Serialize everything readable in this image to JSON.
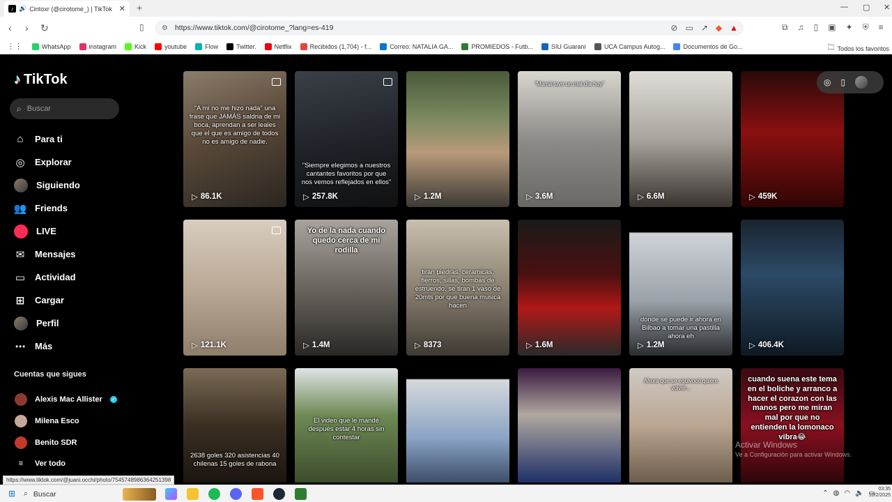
{
  "browser": {
    "tab_title": "Cintoxr (@cirotome_) | TikTok",
    "url": "https://www.tiktok.com/@cirotome_?lang=es-419",
    "bookmarks": [
      {
        "label": "WhatsApp",
        "color": "#25d366"
      },
      {
        "label": "instagram",
        "color": "#e1306c"
      },
      {
        "label": "Kick",
        "color": "#53fc18"
      },
      {
        "label": "youtube",
        "color": "#ff0000"
      },
      {
        "label": "Flow",
        "color": "#00b5ad"
      },
      {
        "label": "Twitter.",
        "color": "#000000"
      },
      {
        "label": "Netflix",
        "color": "#e50914"
      },
      {
        "label": "Recibidos (1,704) - f...",
        "color": "#ea4335"
      },
      {
        "label": "Correo: NATALIA GA...",
        "color": "#0078d4"
      },
      {
        "label": "PROMIEDOS - Futb...",
        "color": "#2e7d32"
      },
      {
        "label": "SIU Guaraní",
        "color": "#1565c0"
      },
      {
        "label": "UCA Campus Autog...",
        "color": "#555555"
      },
      {
        "label": "Documentos de Go...",
        "color": "#4285f4"
      }
    ],
    "bookmarks_folder": "Todos los favoritos"
  },
  "sidebar": {
    "logo": "TikTok",
    "search_placeholder": "Buscar",
    "nav": [
      {
        "label": "Para ti",
        "icon": "home-icon",
        "glyph": "⌂"
      },
      {
        "label": "Explorar",
        "icon": "compass-icon",
        "glyph": "◎"
      },
      {
        "label": "Siguiendo",
        "icon": "avatar",
        "glyph": ""
      },
      {
        "label": "Friends",
        "icon": "friends-icon",
        "glyph": "👥"
      },
      {
        "label": "LIVE",
        "icon": "live-avatar",
        "glyph": ""
      },
      {
        "label": "Mensajes",
        "icon": "message-icon",
        "glyph": "✉"
      },
      {
        "label": "Actividad",
        "icon": "activity-icon",
        "glyph": "▭"
      },
      {
        "label": "Cargar",
        "icon": "upload-icon",
        "glyph": "⊞"
      },
      {
        "label": "Perfil",
        "icon": "profile-avatar",
        "glyph": ""
      },
      {
        "label": "Más",
        "icon": "more-icon",
        "glyph": "⋯"
      }
    ],
    "following_title": "Cuentas que sigues",
    "following": [
      {
        "name": "Alexis Mac Allister",
        "verified": true,
        "color": "#8a3b2e"
      },
      {
        "name": "Milena Esco",
        "verified": false,
        "color": "#c8a89a"
      },
      {
        "name": "Benito SDR",
        "verified": false,
        "color": "#c0392b"
      }
    ],
    "see_all": "Ver todo"
  },
  "videos": [
    {
      "views": "86.1K",
      "caption": "\"A mi no me hizo nada\" una frase que JAMÁS saldria de mi boca, aprendan a ser leales que el que es amigo de todos no es amigo de nadie.",
      "style": "normal",
      "pinned": true,
      "bg": "linear-gradient(160deg,#8b7d6b 0%,#5a4a3a 45%,#2b2620 100%)"
    },
    {
      "views": "257.8K",
      "caption": "\"Siempre elegimos a nuestros cantantes favoritos por que nos vemos reflejados en ellos\"",
      "style": "low",
      "pinned": true,
      "bg": "linear-gradient(170deg,#3a4048 0%,#1c1f24 60%,#111 100%)"
    },
    {
      "views": "1.2M",
      "caption": "",
      "style": "normal",
      "pinned": false,
      "bg": "linear-gradient(180deg,#4a5a3a 0%,#7c8a60 35%,#b89a7a 60%,#3d3a35 100%)"
    },
    {
      "views": "3.6M",
      "caption": "\"Mamá tuve un mal día hoy\"",
      "style": "top",
      "pinned": false,
      "bg": "linear-gradient(180deg,#d9d6cf 0%,#8e8c88 50%,#6a6864 100%)"
    },
    {
      "views": "6.6M",
      "caption": "",
      "style": "normal",
      "pinned": false,
      "bg": "linear-gradient(180deg,#e0ddd8 0%,#a9a49d 50%,#3a3430 100%)"
    },
    {
      "views": "459K",
      "caption": "",
      "style": "normal",
      "pinned": false,
      "bg": "linear-gradient(180deg,#2a0a0a 0%,#8a1010 45%,#300505 100%)"
    },
    {
      "views": "121.1K",
      "caption": "",
      "style": "normal",
      "pinned": true,
      "bg": "linear-gradient(180deg,#d8cdbf 0%,#b9a995 50%,#8f7e6b 100%)"
    },
    {
      "views": "1.4M",
      "caption": "Yo de la nada cuando quedo cerca de mi rodilla",
      "style": "big",
      "pinned": false,
      "bg": "linear-gradient(180deg,#a8a49d 0%,#6a655e 50%,#2a2725 100%)"
    },
    {
      "views": "8373",
      "caption": "tiran piedras, ceramicas, fierros, sillas, bombas de estruendo, se tiran 1 vaso de 20mts por que buena musica hacen",
      "style": "mid",
      "pinned": false,
      "bg": "linear-gradient(180deg,#c9bfae 0%,#8c8272 50%,#3e3a33 100%)"
    },
    {
      "views": "1.6M",
      "caption": "",
      "style": "normal",
      "pinned": false,
      "bg": "linear-gradient(180deg,#1a1a1a 0%,#4a1010 40%,#b01818 65%,#2a2a2a 100%)"
    },
    {
      "views": "1.2M",
      "caption": "dónde se puede ir ahora en Bilbao a tomar una pastilla ahora eh",
      "style": "low",
      "pinned": false,
      "bg": "linear-gradient(180deg,#000 0%,#000 9%,#cfd3d8 10%,#9aa1a8 60%,#2a2d30 100%)"
    },
    {
      "views": "406.4K",
      "caption": "",
      "style": "normal",
      "pinned": false,
      "bg": "linear-gradient(180deg,#1a2430 0%,#2c4a66 40%,#0e1a24 100%)"
    },
    {
      "views": "",
      "caption": "2638 goles 320 asistencias 40 chilenas 15 goles de rabona",
      "style": "bottom",
      "pinned": false,
      "bg": "linear-gradient(180deg,#7a6a55 0%,#3a2e22 50%,#1a1510 100%)"
    },
    {
      "views": "",
      "caption": "El video que le mandé después estar 4 horas sin contestar",
      "style": "mid",
      "pinned": false,
      "bg": "linear-gradient(180deg,#dfe3e6 0%,#6f8a55 40%,#3a4a2a 100%)"
    },
    {
      "views": "",
      "caption": "",
      "style": "normal",
      "pinned": false,
      "bg": "linear-gradient(180deg,#000 0%,#000 9%,#d6d8dc 10%,#8aa4c4 60%,#3a4a66 100%)"
    },
    {
      "views": "",
      "caption": "",
      "style": "normal",
      "pinned": false,
      "bg": "linear-gradient(180deg,#3a1a40 0%,#b0a8a0 40%,#1a2c66 100%)"
    },
    {
      "views": "",
      "caption": "Ahora que se equivocó quiere volver...",
      "style": "top",
      "pinned": false,
      "bg": "linear-gradient(180deg,#cfcac4 0%,#b9a590 50%,#6a5a4a 100%)"
    },
    {
      "views": "",
      "caption": "cuando suena este tema en el boliche y arranco a hacer el corazon con las manos pero me miran mal por que no entienden la lomonaco vibra😂",
      "style": "big",
      "pinned": false,
      "bg": "linear-gradient(180deg,#3a0a12 0%,#8a1020 50%,#2a0508 100%)"
    }
  ],
  "windows_watermark": {
    "title": "Activar Windows",
    "subtitle": "Ve a Configuración para activar Windows."
  },
  "status_url": "https://www.tiktok.com/@juani.occhi/photo/7545748986364251398",
  "taskbar": {
    "search": "Buscar",
    "time": "03:35",
    "date": "10/2/2025"
  }
}
